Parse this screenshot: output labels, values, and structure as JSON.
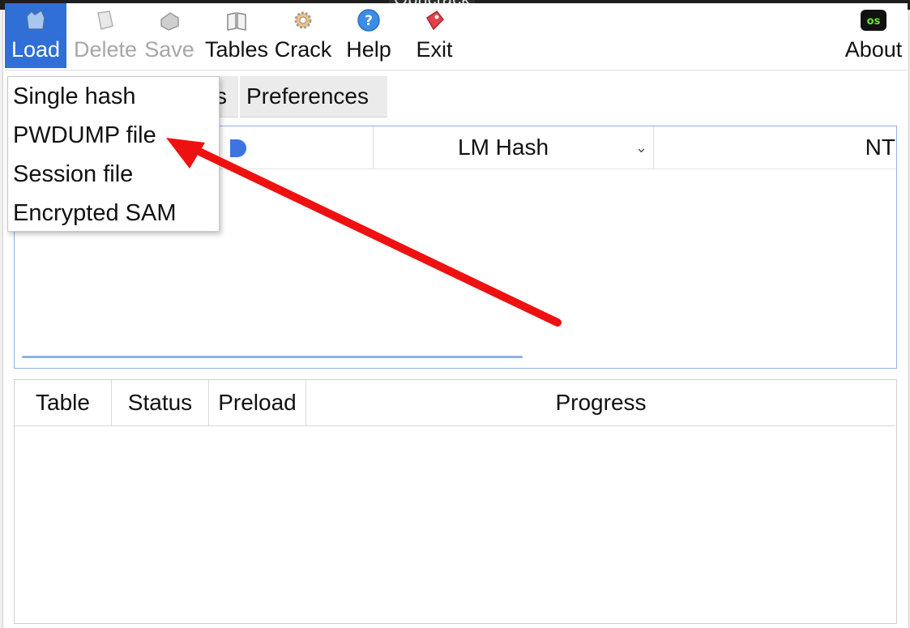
{
  "titlebar": {
    "title": "Ophcrack"
  },
  "toolbar": {
    "buttons": [
      {
        "label": "Load",
        "icon": "load-icon",
        "state": "active"
      },
      {
        "label": "Delete",
        "icon": "delete-icon",
        "state": "disabled"
      },
      {
        "label": "Save",
        "icon": "save-icon",
        "state": "disabled"
      },
      {
        "label": "Tables",
        "icon": "tables-icon",
        "state": "normal"
      },
      {
        "label": "Crack",
        "icon": "crack-icon",
        "state": "normal"
      },
      {
        "label": "Help",
        "icon": "help-icon",
        "state": "normal"
      },
      {
        "label": "Exit",
        "icon": "exit-icon",
        "state": "normal"
      },
      {
        "label": "About",
        "icon": "os-logo-icon",
        "state": "normal"
      }
    ]
  },
  "tabs": {
    "partial_label": "s",
    "preferences": "Preferences"
  },
  "hash_table": {
    "columns": {
      "lm_hash": "LM Hash",
      "nt_hash": "NT"
    }
  },
  "tables_table": {
    "columns": {
      "table": "Table",
      "status": "Status",
      "preload": "Preload",
      "progress": "Progress"
    }
  },
  "load_menu": {
    "items": [
      "Single hash",
      "PWDUMP file",
      "Session file",
      "Encrypted SAM"
    ]
  },
  "colors": {
    "accent": "#2f6fd6",
    "annotation_arrow": "#ee1111",
    "panel_border": "#8fb1e6"
  }
}
